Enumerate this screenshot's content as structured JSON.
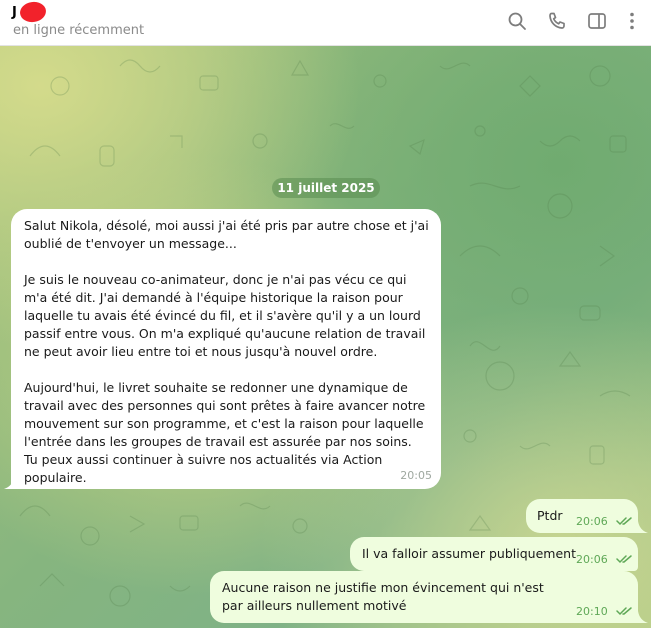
{
  "header": {
    "contact_name": "J",
    "contact_status": "en ligne récemment",
    "icons": [
      "search-icon",
      "phone-icon",
      "sidebar-toggle-icon",
      "more-vertical-icon"
    ]
  },
  "chat": {
    "date_separator": "11 juillet 2025",
    "incoming": {
      "paragraphs": [
        "Salut Nikola, désolé, moi aussi j'ai été pris par autre chose et j'ai oublié de t'envoyer un message...",
        "Je suis le nouveau co-animateur, donc je n'ai pas vécu ce qui m'a été dit. J'ai demandé à l'équipe historique la raison pour laquelle tu avais été évincé du fil, et il s'avère qu'il y a un lourd passif entre vous. On m'a expliqué qu'aucune relation de travail ne peut avoir lieu entre toi et nous jusqu'à nouvel ordre.",
        "Aujourd'hui, le livret souhaite se redonner une dynamique de travail avec des personnes qui sont prêtes à faire avancer notre mouvement sur son programme, et c'est la raison pour laquelle l'entrée dans les groupes de travail est assurée par nos soins. Tu peux aussi continuer à suivre nos actualités via Action populaire."
      ],
      "time": "20:05"
    },
    "outgoing": [
      {
        "text": "Ptdr",
        "time": "20:06"
      },
      {
        "text": "Il va falloir assumer publiquement",
        "time": "20:06"
      },
      {
        "text": "Aucune raison ne justifie mon évincement qui n'est par ailleurs nullement motivé",
        "time": "20:10"
      }
    ]
  },
  "colors": {
    "incoming_bubble": "#ffffff",
    "outgoing_bubble": "#effdde",
    "outgoing_time": "#5fa857",
    "redaction": "#f2222b"
  }
}
